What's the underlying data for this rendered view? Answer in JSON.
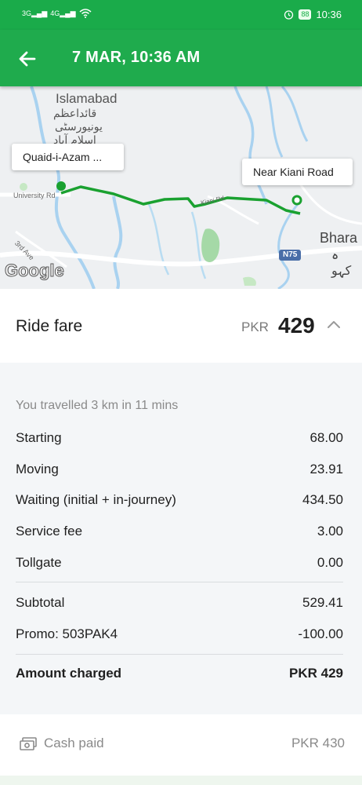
{
  "status": {
    "network_left": "3G",
    "network_right": "4G",
    "battery": "88",
    "time": "10:36"
  },
  "header": {
    "title": "7 MAR, 10:36 AM"
  },
  "map": {
    "labels": {
      "campus_en": "Islamabad",
      "campus_ur1": "قائداعظم",
      "campus_ur2": "یونیورسٹی",
      "campus_ur3": "اسلام آباد",
      "university_rd": "University Rd",
      "kiani_rd": "Kiani Rd",
      "third_ave": "3rd Ave",
      "bhara": "Bhara",
      "bhara_ur": "ہ کہو",
      "n75": "N75",
      "google": "Google"
    },
    "pickup_label": "Quaid-i-Azam ...",
    "dropoff_label": "Near Kiani Road",
    "route_color": "#1aa130"
  },
  "fare": {
    "label": "Ride fare",
    "currency": "PKR",
    "amount": "429"
  },
  "breakdown": {
    "note": "You travelled 3 km in 11 mins",
    "items": [
      {
        "label": "Starting",
        "value": "68.00"
      },
      {
        "label": "Moving",
        "value": "23.91"
      },
      {
        "label": "Waiting (initial + in-journey)",
        "value": "434.50"
      },
      {
        "label": "Service fee",
        "value": "3.00"
      },
      {
        "label": "Tollgate",
        "value": "0.00"
      }
    ],
    "subtotal": {
      "label": "Subtotal",
      "value": "529.41"
    },
    "promo": {
      "label": "Promo: 503PAK4",
      "value": "-100.00"
    },
    "charged": {
      "label": "Amount charged",
      "value": "PKR 429"
    }
  },
  "payment": {
    "label": "Cash paid",
    "amount": "PKR 430"
  }
}
